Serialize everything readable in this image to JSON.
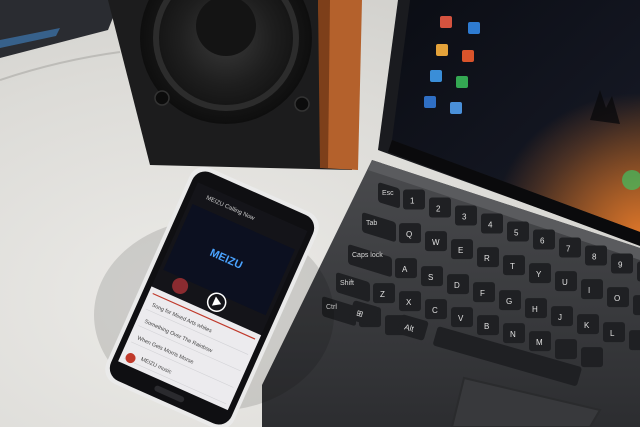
{
  "phone": {
    "header_title": "MEIZU Calling Now",
    "art_text": "MEIZU",
    "songs": [
      "Song for Mixed Arts whites",
      "Something Over The Rainbow",
      "When Gets Morris Morse",
      "MEIZU music"
    ]
  },
  "keyboard": {
    "keys": {
      "tab": "Tab",
      "caps": "Caps lock",
      "shift": "Shift",
      "ctrl": "Ctrl",
      "alt": "Alt",
      "esc": "Esc"
    },
    "letters_row1": [
      "Q",
      "W",
      "E",
      "R",
      "T",
      "Y",
      "U",
      "I",
      "O"
    ],
    "letters_row2": [
      "A",
      "S",
      "D",
      "F",
      "G",
      "H",
      "J",
      "K",
      "L"
    ],
    "letters_row3": [
      "Z",
      "X",
      "C",
      "V",
      "B",
      "N",
      "M"
    ],
    "numbers_row": [
      "1",
      "2",
      "3",
      "4",
      "5",
      "6",
      "7",
      "8",
      "9",
      "0"
    ]
  },
  "colors": {
    "phone_accent": "#c0392b",
    "speaker_wood": "#b4612c",
    "tablet_glow": "#d9772a"
  }
}
